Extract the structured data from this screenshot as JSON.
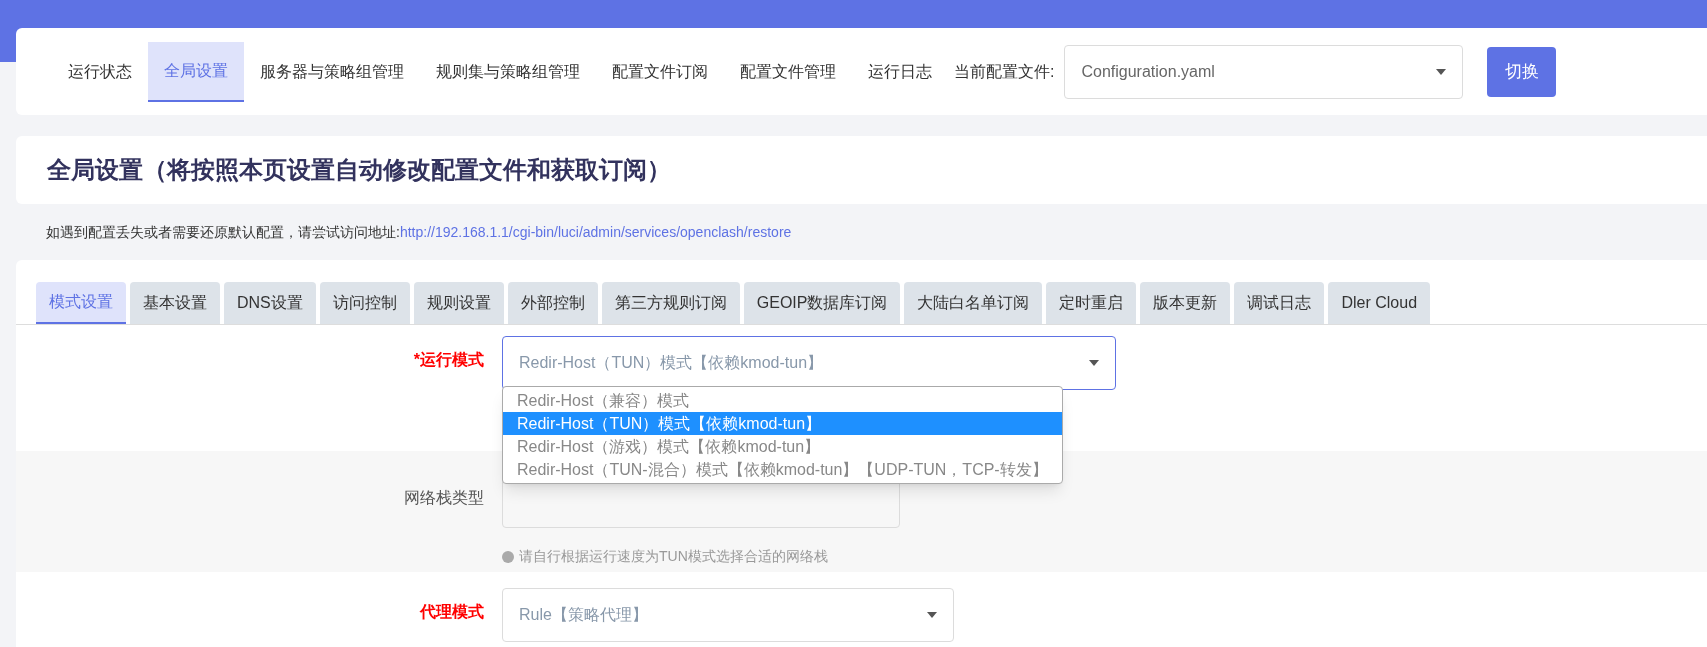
{
  "top_nav": {
    "items": [
      {
        "label": "运行状态",
        "selected": false
      },
      {
        "label": "全局设置",
        "selected": true
      },
      {
        "label": "服务器与策略组管理",
        "selected": false
      },
      {
        "label": "规则集与策略组管理",
        "selected": false
      },
      {
        "label": "配置文件订阅",
        "selected": false
      },
      {
        "label": "配置文件管理",
        "selected": false
      },
      {
        "label": "运行日志",
        "selected": false
      }
    ],
    "config_label": "当前配置文件:",
    "config_value": "Configuration.yaml",
    "switch_button": "切换"
  },
  "page_title": "全局设置（将按照本页设置自动修改配置文件和获取订阅）",
  "notice": {
    "text": "如遇到配置丢失或者需要还原默认配置，请尝试访问地址: ",
    "link": "http://192.168.1.1/cgi-bin/luci/admin/services/openclash/restore"
  },
  "tabs": [
    {
      "label": "模式设置",
      "selected": true
    },
    {
      "label": "基本设置",
      "selected": false
    },
    {
      "label": "DNS设置",
      "selected": false
    },
    {
      "label": "访问控制",
      "selected": false
    },
    {
      "label": "规则设置",
      "selected": false
    },
    {
      "label": "外部控制",
      "selected": false
    },
    {
      "label": "第三方规则订阅",
      "selected": false
    },
    {
      "label": "GEOIP数据库订阅",
      "selected": false
    },
    {
      "label": "大陆白名单订阅",
      "selected": false
    },
    {
      "label": "定时重启",
      "selected": false
    },
    {
      "label": "版本更新",
      "selected": false
    },
    {
      "label": "调试日志",
      "selected": false
    },
    {
      "label": "Dler Cloud",
      "selected": false
    }
  ],
  "form": [
    {
      "label": "*运行模式",
      "required": true,
      "shaded": false,
      "value": "Redir-Host（TUN）模式【依赖kmod-tun】",
      "open": true,
      "options": [
        {
          "label": "Redir-Host（兼容）模式",
          "selected": false
        },
        {
          "label": "Redir-Host（TUN）模式【依赖kmod-tun】",
          "selected": true
        },
        {
          "label": "Redir-Host（游戏）模式【依赖kmod-tun】",
          "selected": false
        },
        {
          "label": "Redir-Host（TUN-混合）模式【依赖kmod-tun】【UDP-TUN，TCP-转发】",
          "selected": false
        }
      ]
    },
    {
      "label": "网络栈类型",
      "required": false,
      "shaded": true,
      "hint": "请自行根据运行速度为TUN模式选择合适的网络栈"
    },
    {
      "label": "代理模式",
      "required": true,
      "shaded": false,
      "value": "Rule【策略代理】"
    }
  ]
}
